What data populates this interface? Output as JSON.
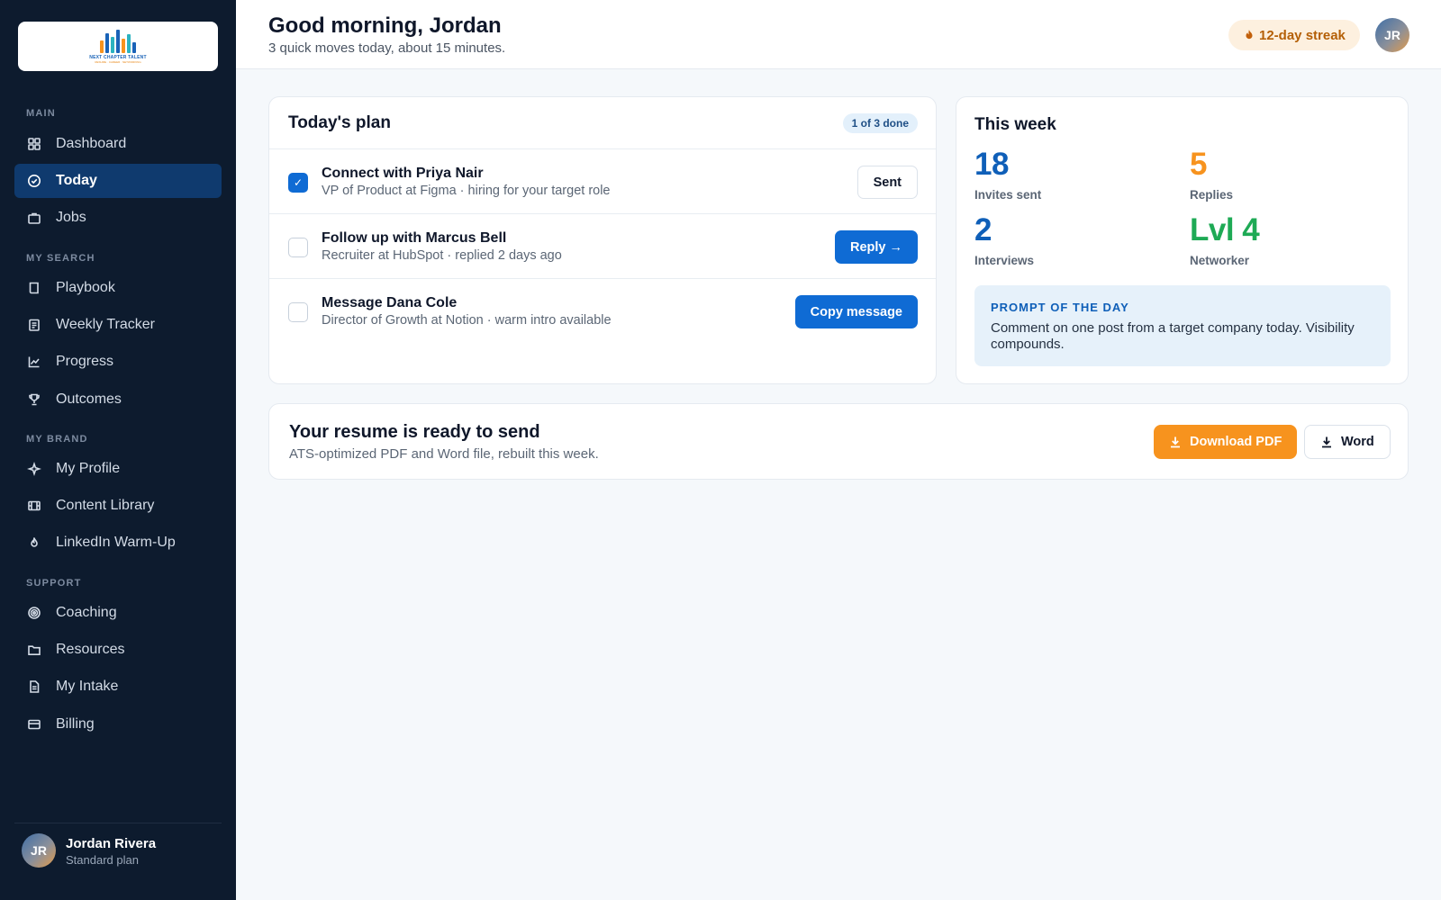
{
  "brand": {
    "logo_text": "NEXT CHAPTER TALENT",
    "logo_tagline": "RESUME · CAREER · NETWORKING"
  },
  "sidebar": {
    "sections": [
      {
        "label": "MAIN",
        "items": [
          {
            "label": "Dashboard",
            "icon": "grid-icon",
            "active": false
          },
          {
            "label": "Today",
            "icon": "check-circle-icon",
            "active": true
          },
          {
            "label": "Jobs",
            "icon": "briefcase-icon",
            "active": false
          }
        ]
      },
      {
        "label": "MY SEARCH",
        "items": [
          {
            "label": "Playbook",
            "icon": "book-icon",
            "active": false
          },
          {
            "label": "Weekly Tracker",
            "icon": "clipboard-icon",
            "active": false
          },
          {
            "label": "Progress",
            "icon": "chart-line-icon",
            "active": false
          },
          {
            "label": "Outcomes",
            "icon": "trophy-icon",
            "active": false
          }
        ]
      },
      {
        "label": "MY BRAND",
        "items": [
          {
            "label": "My Profile",
            "icon": "sparkle-icon",
            "active": false
          },
          {
            "label": "Content Library",
            "icon": "film-icon",
            "active": false
          },
          {
            "label": "LinkedIn Warm-Up",
            "icon": "flame-icon",
            "active": false
          }
        ]
      },
      {
        "label": "SUPPORT",
        "items": [
          {
            "label": "Coaching",
            "icon": "target-icon",
            "active": false
          },
          {
            "label": "Resources",
            "icon": "folder-icon",
            "active": false
          },
          {
            "label": "My Intake",
            "icon": "document-icon",
            "active": false
          },
          {
            "label": "Billing",
            "icon": "credit-card-icon",
            "active": false
          }
        ]
      }
    ],
    "user": {
      "initials": "JR",
      "name": "Jordan Rivera",
      "plan": "Standard plan"
    }
  },
  "header": {
    "greeting": "Good morning, Jordan",
    "subtitle": "3 quick moves today, about 15 minutes.",
    "streak": "12-day streak",
    "avatar_initials": "JR"
  },
  "plan": {
    "title": "Today's plan",
    "badge": "1 of 3 done",
    "tasks": [
      {
        "title": "Connect with Priya Nair",
        "role": "VP of Product at Figma",
        "note": "hiring for your target role",
        "action": "Sent",
        "done": true
      },
      {
        "title": "Follow up with Marcus Bell",
        "role": "Recruiter at HubSpot",
        "note": "replied 2 days ago",
        "action": "Reply →",
        "done": false
      },
      {
        "title": "Message Dana Cole",
        "role": "Director of Growth at Notion",
        "note": "warm intro available",
        "action": "Copy message",
        "done": false
      }
    ]
  },
  "week": {
    "title": "This week",
    "stats": [
      {
        "value": "18",
        "label": "Invites sent",
        "color": "#0f5fb8"
      },
      {
        "value": "5",
        "label": "Replies",
        "color": "#f7931e"
      },
      {
        "value": "2",
        "label": "Interviews",
        "color": "#0f5fb8"
      },
      {
        "value": "Lvl 4",
        "label": "Networker",
        "color": "#1eaa55"
      }
    ],
    "prompt_heading": "PROMPT OF THE DAY",
    "prompt_text": "Comment on one post from a target company today. Visibility compounds."
  },
  "resume": {
    "title": "Your resume is ready to send",
    "subtitle": "ATS-optimized PDF and Word file, rebuilt this week.",
    "pdf_label": "Download PDF",
    "word_label": "Word"
  }
}
